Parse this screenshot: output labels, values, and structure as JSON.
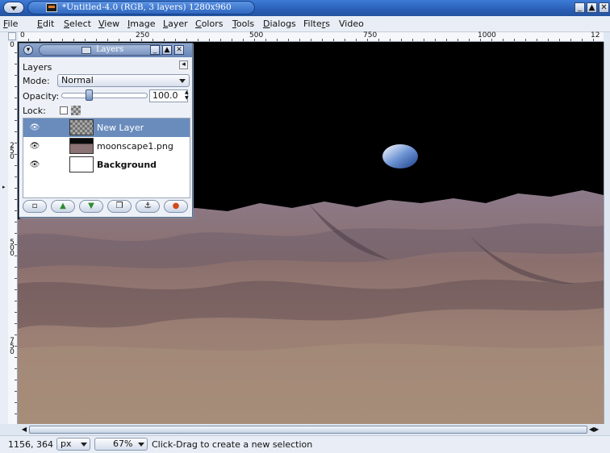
{
  "window": {
    "title": "*Untitled-4.0 (RGB, 3 layers) 1280x960",
    "buttons": [
      "_",
      "▲",
      "✕"
    ]
  },
  "menubar": [
    {
      "label": "File",
      "underline": "F"
    },
    {
      "label": "Edit",
      "underline": "E"
    },
    {
      "label": "Select",
      "underline": "S"
    },
    {
      "label": "View",
      "underline": "V"
    },
    {
      "label": "Image",
      "underline": "I"
    },
    {
      "label": "Layer",
      "underline": "L"
    },
    {
      "label": "Colors",
      "underline": "C"
    },
    {
      "label": "Tools",
      "underline": "T"
    },
    {
      "label": "Dialogs",
      "underline": "D"
    },
    {
      "label": "Filters",
      "underline": "r"
    },
    {
      "label": "Video",
      "underline": ""
    }
  ],
  "ruler": {
    "h_labels": [
      "0",
      "250",
      "500",
      "750",
      "1000",
      "12"
    ],
    "v_labels": [
      "0",
      "250",
      "500",
      "750"
    ]
  },
  "layers_dialog": {
    "title": "Layers",
    "panel_label": "Layers",
    "mode_label": "Mode:",
    "mode_value": "Normal",
    "opacity_label": "Opacity:",
    "opacity_value": "100.0",
    "opacity_fraction": 1.0,
    "lock_label": "Lock:",
    "layers": [
      {
        "name": "New Layer",
        "selected": true,
        "visible": true,
        "bold": false
      },
      {
        "name": "moonscape1.png",
        "selected": false,
        "visible": true,
        "bold": false
      },
      {
        "name": "Background",
        "selected": false,
        "visible": true,
        "bold": true
      }
    ],
    "buttons": [
      {
        "name": "new-layer-button",
        "icon": "new-layer-icon"
      },
      {
        "name": "raise-layer-button",
        "icon": "up-arrow-icon"
      },
      {
        "name": "lower-layer-button",
        "icon": "down-arrow-icon"
      },
      {
        "name": "duplicate-layer-button",
        "icon": "duplicate-icon"
      },
      {
        "name": "anchor-layer-button",
        "icon": "anchor-icon"
      },
      {
        "name": "delete-layer-button",
        "icon": "delete-icon"
      }
    ]
  },
  "statusbar": {
    "coords": "1156, 364",
    "unit": "px",
    "zoom": "67%",
    "hint": "Click-Drag to create a new selection"
  },
  "colors": {
    "titlebar": "#2a5fb6",
    "selection": "#6a8cbd"
  }
}
